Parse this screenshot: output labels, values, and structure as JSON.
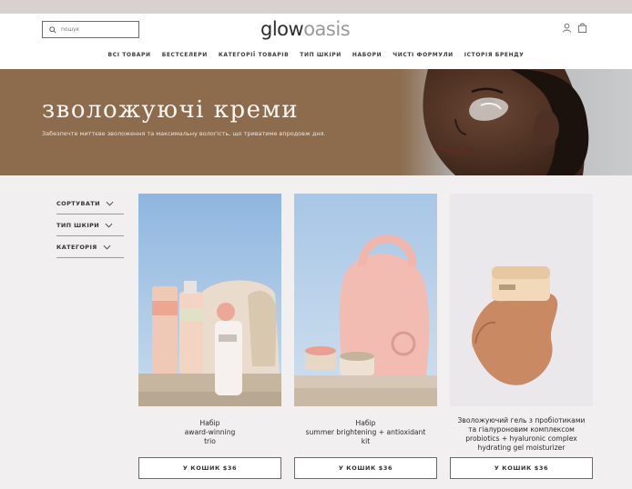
{
  "header": {
    "search": {
      "placeholder": "пошук",
      "icon": "search-icon"
    },
    "logo": {
      "bold": "glow",
      "light": "oasis"
    },
    "icons": [
      "user-icon",
      "shopping-bag-icon"
    ]
  },
  "nav": {
    "items": [
      "ВСІ ТОВАРИ",
      "БЕСТСЕЛЕРИ",
      "КАТЕГОРІЇ ТОВАРІВ",
      "ТИП ШКІРИ",
      "НАБОРИ",
      "ЧИСТІ ФОРМУЛИ",
      "ІСТОРІЯ БРЕНДУ"
    ]
  },
  "banner": {
    "title": "зволожуючі креми",
    "subtitle": "Забезпечте миттєве зволоження та максимальну вологість, що триватиме впродовж дня."
  },
  "filters": {
    "items": [
      "СОРТУВАТИ",
      "ТИП ШКІРИ",
      "КАТЕГОРІЯ"
    ]
  },
  "products": [
    {
      "name": "Набір\naward-winning\ntrio",
      "button": "У КОШИК $36"
    },
    {
      "name": "Набір\nsummer brightening + antioxidant\nkit",
      "button": "У КОШИК $36"
    },
    {
      "name": "Зволожуючий гель з пробіотиками\nта гіалуроновим комплексом\nprobiotics + hyaluronic complex\nhydrating gel moisturizer",
      "button": "У КОШИК $36"
    }
  ],
  "colors": {
    "banner": "#8c6c4d",
    "background": "#f2eff1",
    "top_strip": "#d8d1cf"
  }
}
